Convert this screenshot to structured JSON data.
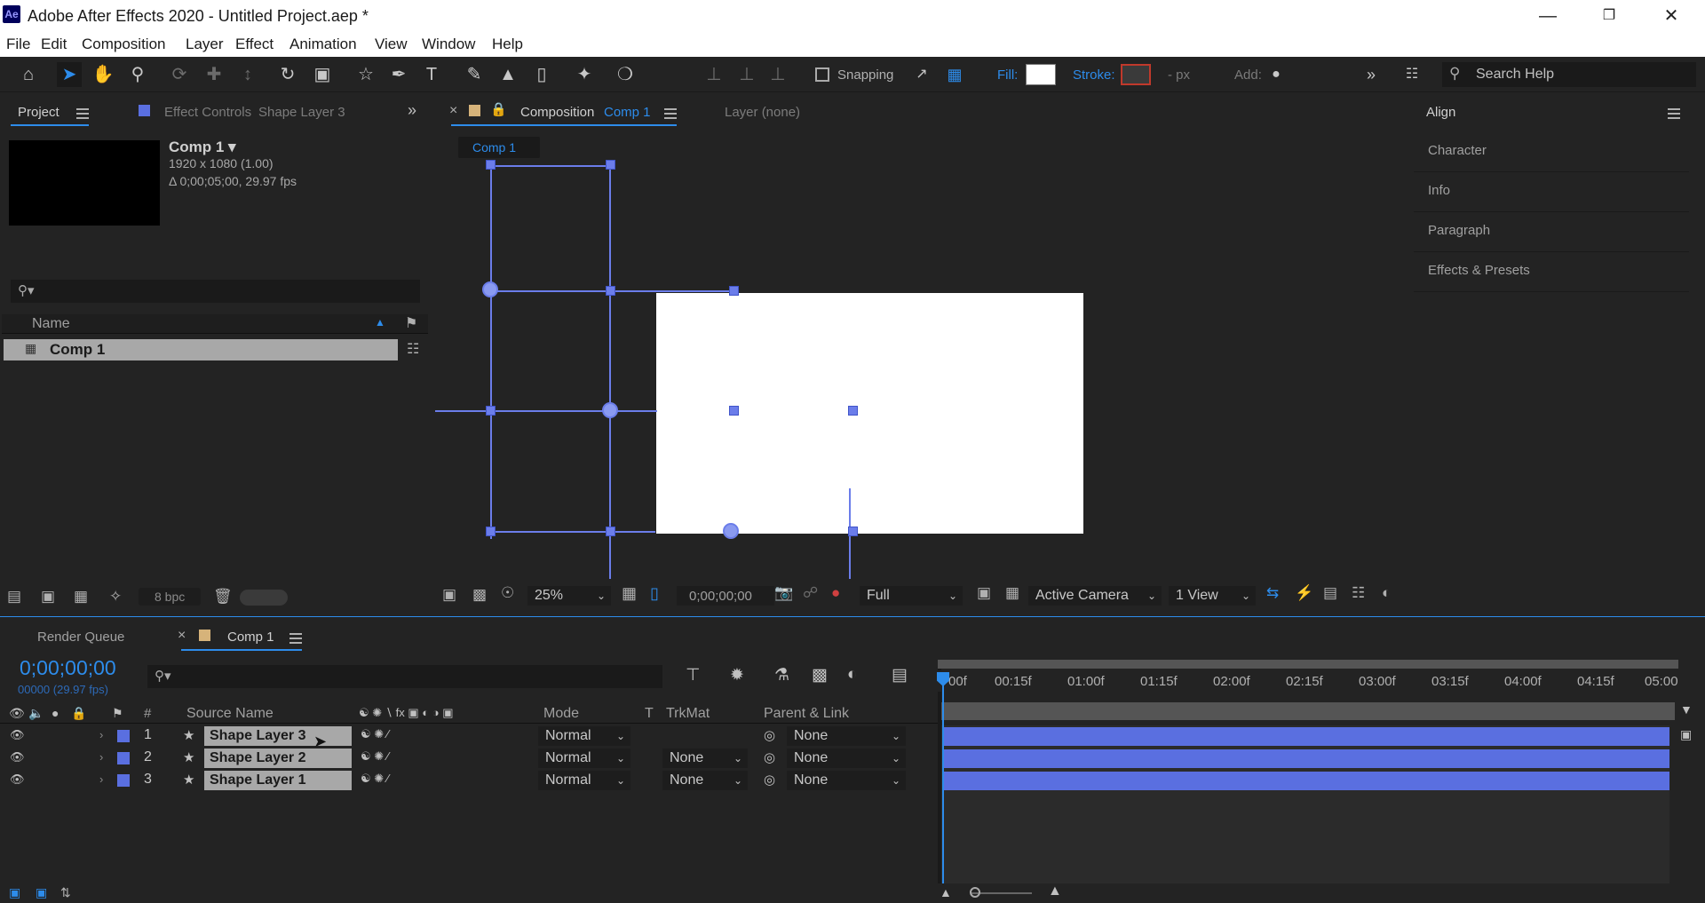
{
  "window": {
    "title": "Adobe After Effects 2020 - Untitled Project.aep *",
    "logo": "Ae"
  },
  "menu": [
    "File",
    "Edit",
    "Composition",
    "Layer",
    "Effect",
    "Animation",
    "View",
    "Window",
    "Help"
  ],
  "toolbar": {
    "snapping": "Snapping",
    "fill": "Fill:",
    "stroke": "Stroke:",
    "stroke_units": "- px",
    "add": "Add:",
    "search": "Search Help"
  },
  "project": {
    "tab": "Project",
    "effect_controls": "Effect Controls",
    "effect_controls_layer": "Shape Layer 3",
    "comp_name": "Comp 1 ▾",
    "comp_size": "1920 x 1080 (1.00)",
    "comp_duration": "Δ 0;00;05;00, 29.97 fps",
    "col_name": "Name",
    "item": "Comp 1",
    "bpc": "8 bpc"
  },
  "viewer": {
    "tab_label": "Composition",
    "tab_comp": "Comp 1",
    "layer_tab": "Layer (none)",
    "subtab": "Comp 1",
    "zoom": "25%",
    "timecode": "0;00;00;00",
    "resolution": "Full",
    "camera": "Active Camera",
    "views": "1 View"
  },
  "right_panels": [
    "Align",
    "Character",
    "Info",
    "Paragraph",
    "Effects & Presets"
  ],
  "timeline": {
    "render_queue": "Render Queue",
    "comp_tab": "Comp 1",
    "timecode": "0;00;00;00",
    "frames": "00000 (29.97 fps)",
    "headers": {
      "num": "#",
      "source": "Source Name",
      "mode": "Mode",
      "t": "T",
      "trkmat": "TrkMat",
      "parent": "Parent & Link"
    },
    "ruler": [
      "00f",
      "00:15f",
      "01:00f",
      "01:15f",
      "02:00f",
      "02:15f",
      "03:00f",
      "03:15f",
      "04:00f",
      "04:15f",
      "05:00"
    ],
    "layers": [
      {
        "num": "1",
        "name": "Shape Layer 3",
        "mode": "Normal",
        "trkmat": "",
        "parent": "None"
      },
      {
        "num": "2",
        "name": "Shape Layer 2",
        "mode": "Normal",
        "trkmat": "None",
        "parent": "None"
      },
      {
        "num": "3",
        "name": "Shape Layer 1",
        "mode": "Normal",
        "trkmat": "None",
        "parent": "None"
      }
    ]
  },
  "colors": {
    "accent": "#2d8ceb",
    "label_blue": "#5a6fe0",
    "comp_white": "#ffffff"
  }
}
